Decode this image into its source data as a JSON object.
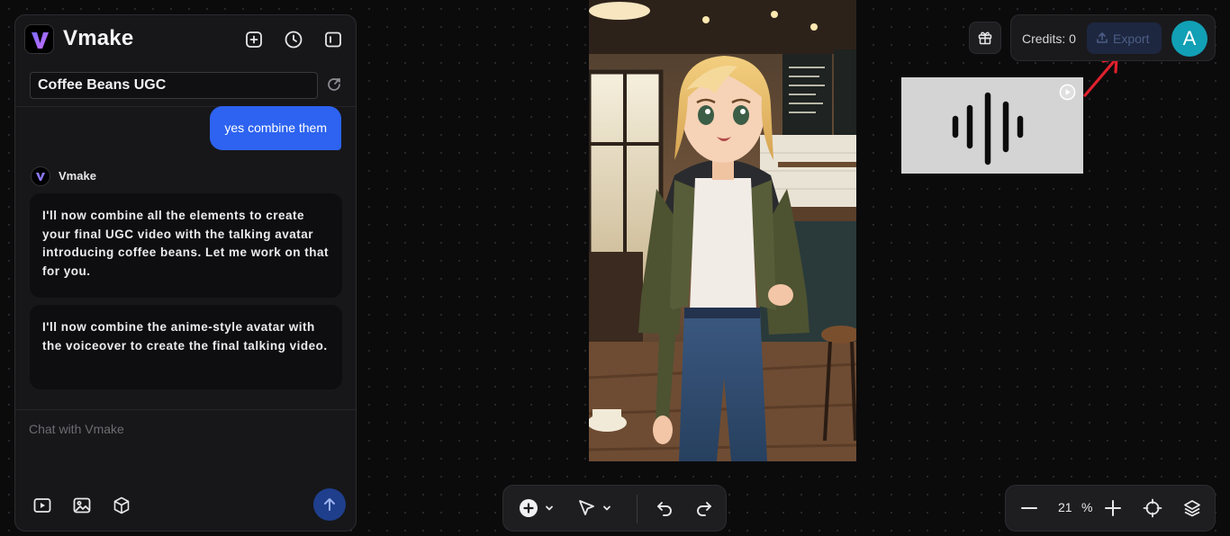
{
  "app": {
    "name": "Vmake"
  },
  "project": {
    "title": "Coffee Beans UGC"
  },
  "header_icons": [
    "new-chat-icon",
    "history-icon",
    "collapse-panel-icon"
  ],
  "chat": {
    "messages": [
      {
        "role": "user",
        "text": "yes combine them"
      },
      {
        "role": "assistant",
        "sender": "Vmake"
      },
      {
        "role": "assistant",
        "text": "I'll now combine all the elements to create your final UGC video with the talking avatar introducing coffee beans. Let me work on that for you."
      },
      {
        "role": "assistant",
        "text": "I'll now combine the anime-style avatar with the voiceover to create the final talking video."
      }
    ],
    "input_placeholder": "Chat with Vmake",
    "tools": [
      "video-icon",
      "image-icon",
      "3d-box-icon"
    ],
    "send_icon": "arrow-up-icon"
  },
  "topbar": {
    "credits": "Credits: 0",
    "export_label": "Export",
    "avatar_initial": "A",
    "gift_icon": "gift-icon"
  },
  "canvas": {
    "media": [
      "anime-girl-cafe-image",
      "audio-waveform-card"
    ],
    "annotation": "red-arrow-pointing-to-export"
  },
  "bottom_toolbar": {
    "tools": [
      "add-icon",
      "pointer-icon",
      "undo-icon",
      "redo-icon"
    ]
  },
  "zoom": {
    "value": "21",
    "unit": "%"
  },
  "colors": {
    "accent_blue": "#2d63f0",
    "avatar_teal": "#11a0b5",
    "background": "#0b0b0c",
    "panel": "#17171a"
  }
}
